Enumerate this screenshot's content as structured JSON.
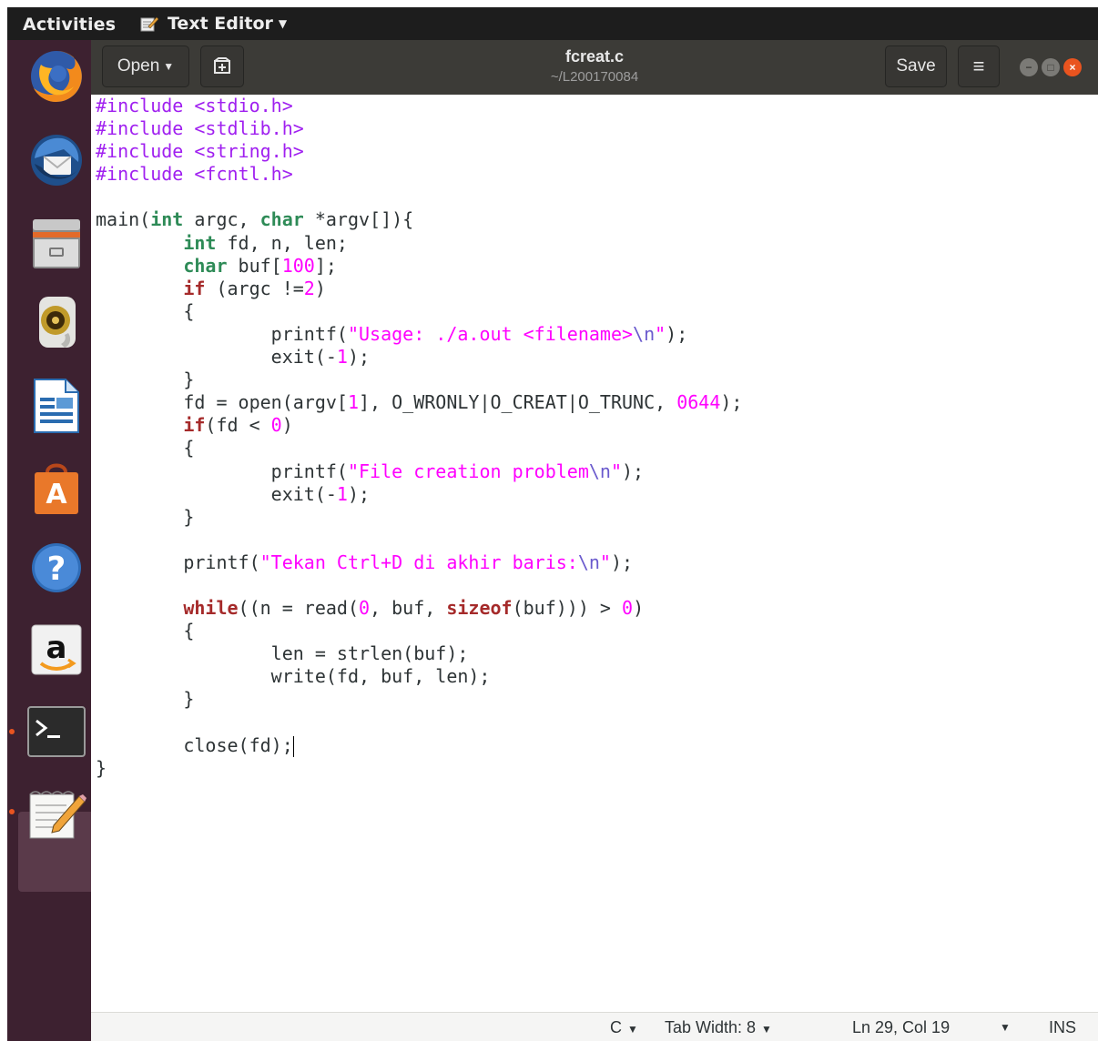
{
  "shell": {
    "activities": "Activities",
    "app_name": "Text Editor",
    "app_icon": "text-editor-icon"
  },
  "launcher": {
    "items": [
      {
        "name": "Firefox",
        "icon": "firefox-icon"
      },
      {
        "name": "Thunderbird",
        "icon": "thunderbird-icon"
      },
      {
        "name": "Files",
        "icon": "files-icon"
      },
      {
        "name": "Rhythmbox",
        "icon": "rhythmbox-icon"
      },
      {
        "name": "LibreOffice Writer",
        "icon": "writer-icon"
      },
      {
        "name": "Ubuntu Software",
        "icon": "software-icon"
      },
      {
        "name": "Help",
        "icon": "help-icon"
      },
      {
        "name": "Amazon",
        "icon": "amazon-icon"
      },
      {
        "name": "Terminal",
        "icon": "terminal-icon"
      },
      {
        "name": "Text Editor",
        "icon": "gedit-icon"
      }
    ]
  },
  "header": {
    "open_label": "Open",
    "title": "fcreat.c",
    "subtitle": "~/L200170084",
    "save_label": "Save"
  },
  "code_lines": [
    "#include <stdio.h>",
    "#include <stdlib.h>",
    "#include <string.h>",
    "#include <fcntl.h>",
    "",
    "main(int argc, char *argv[]){",
    "        int fd, n, len;",
    "        char buf[100];",
    "        if (argc !=2)",
    "        {",
    "                printf(\"Usage: ./a.out <filename>\\n\");",
    "                exit(-1);",
    "        }",
    "        fd = open(argv[1], O_WRONLY|O_CREAT|O_TRUNC, 0644);",
    "        if(fd < 0)",
    "        {",
    "                printf(\"File creation problem\\n\");",
    "                exit(-1);",
    "        }",
    "",
    "        printf(\"Tekan Ctrl+D di akhir baris:\\n\");",
    "",
    "        while((n = read(0, buf, sizeof(buf))) > 0)",
    "        {",
    "                len = strlen(buf);",
    "                write(fd, buf, len);",
    "        }",
    "",
    "        close(fd);",
    "}"
  ],
  "status": {
    "language": "C",
    "tab_width": "Tab Width: 8",
    "position": "Ln 29, Col 19",
    "mode": "INS"
  },
  "colors": {
    "launcher_bg": "#3d2130",
    "header_bg": "#3c3b37",
    "accent": "#e95420",
    "preprocessor": "#a020f0",
    "keyword": "#a52a2a",
    "type": "#2e8b57",
    "string": "#ff00ff"
  }
}
